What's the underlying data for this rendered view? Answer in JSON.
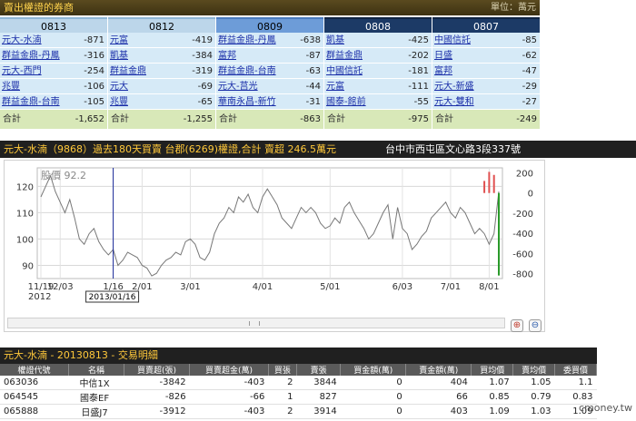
{
  "header": {
    "title": "賣出權證的券商",
    "unit": "單位：萬元"
  },
  "columns": [
    {
      "date": "0813",
      "rows": [
        {
          "name": "元大-水湳",
          "value": "-871"
        },
        {
          "name": "群益金鼎-丹鳳",
          "value": "-316"
        },
        {
          "name": "元大-西門",
          "value": "-254"
        },
        {
          "name": "兆豐",
          "value": "-106"
        },
        {
          "name": "群益金鼎-台南",
          "value": "-105"
        }
      ],
      "total_label": "合計",
      "total": "-1,652"
    },
    {
      "date": "0812",
      "rows": [
        {
          "name": "元富",
          "value": "-419"
        },
        {
          "name": "凱基",
          "value": "-384"
        },
        {
          "name": "群益金鼎",
          "value": "-319"
        },
        {
          "name": "元大",
          "value": "-69"
        },
        {
          "name": "兆豐",
          "value": "-65"
        }
      ],
      "total_label": "合計",
      "total": "-1,255"
    },
    {
      "date": "0809",
      "rows": [
        {
          "name": "群益金鼎-丹鳳",
          "value": "-638"
        },
        {
          "name": "富邦",
          "value": "-87"
        },
        {
          "name": "群益金鼎-台南",
          "value": "-63"
        },
        {
          "name": "元大-莒光",
          "value": "-44"
        },
        {
          "name": "華南永昌-新竹",
          "value": "-31"
        }
      ],
      "total_label": "合計",
      "total": "-863"
    },
    {
      "date": "0808",
      "rows": [
        {
          "name": "凱基",
          "value": "-425"
        },
        {
          "name": "群益金鼎",
          "value": "-202"
        },
        {
          "name": "中國信託",
          "value": "-181"
        },
        {
          "name": "元富",
          "value": "-111"
        },
        {
          "name": "國泰-館前",
          "value": "-55"
        }
      ],
      "total_label": "合計",
      "total": "-975"
    },
    {
      "date": "0807",
      "rows": [
        {
          "name": "中國信託",
          "value": "-85"
        },
        {
          "name": "日盛",
          "value": "-62"
        },
        {
          "name": "富邦",
          "value": "-47"
        },
        {
          "name": "元大-新盛",
          "value": "-29"
        },
        {
          "name": "元大-雙和",
          "value": "-27"
        }
      ],
      "total_label": "合計",
      "total": "-249"
    }
  ],
  "chart_title": "元大-水湳（9868）過去180天買賣 台郡(6269)權證,合計  賣超 246.5萬元",
  "chart_address": "台中市西屯區文心路3段337號",
  "chart_data": {
    "type": "line",
    "legend_label": "股價 92.2",
    "cursor_label": "2013/01/16",
    "x_ticks": [
      "11/19",
      "12/03",
      "1/16",
      "2/01",
      "3/01",
      "4/01",
      "5/01",
      "6/03",
      "7/01",
      "8/01"
    ],
    "year_labels": [
      "2012",
      "2013"
    ],
    "y_left_ticks": [
      90,
      100,
      110,
      120
    ],
    "y_right_ticks": [
      200,
      0,
      -200,
      -400,
      -600,
      -800
    ],
    "ylim_left": [
      85,
      127
    ],
    "ylim_right": [
      -850,
      250
    ],
    "price_series": [
      116,
      120,
      124,
      118,
      114,
      110,
      115,
      108,
      100,
      98,
      102,
      104,
      99,
      96,
      94,
      96,
      90,
      92,
      95,
      94,
      93,
      90,
      89,
      86,
      87,
      90,
      92,
      93,
      95,
      94,
      99,
      100,
      98,
      93,
      92,
      95,
      102,
      106,
      108,
      112,
      110,
      116,
      114,
      117,
      112,
      110,
      116,
      119,
      116,
      113,
      108,
      106,
      104,
      108,
      112,
      110,
      112,
      110,
      106,
      104,
      105,
      108,
      106,
      112,
      114,
      110,
      107,
      104,
      100,
      102,
      106,
      110,
      113,
      100,
      112,
      104,
      102,
      96,
      98,
      101,
      103,
      108,
      110,
      112,
      114,
      110,
      108,
      112,
      110,
      106,
      102,
      104,
      102,
      98,
      102,
      118
    ],
    "net_series": [
      0,
      0,
      0,
      0,
      0,
      0,
      0,
      0,
      0,
      0,
      0,
      0,
      0,
      0,
      0,
      0,
      0,
      0,
      0,
      0,
      0,
      0,
      0,
      0,
      0,
      0,
      0,
      0,
      0,
      0,
      0,
      0,
      0,
      0,
      0,
      0,
      0,
      0,
      0,
      0,
      0,
      0,
      0,
      0,
      0,
      0,
      0,
      0,
      0,
      0,
      0,
      0,
      0,
      0,
      0,
      0,
      0,
      0,
      0,
      0,
      0,
      0,
      0,
      0,
      0,
      0,
      0,
      0,
      0,
      0,
      0,
      0,
      0,
      0,
      0,
      0,
      0,
      0,
      0,
      0,
      0,
      0,
      0,
      0,
      0,
      0,
      0,
      0,
      0,
      0,
      0,
      0,
      120,
      210,
      180,
      -820
    ],
    "colors": {
      "price_line": "#777777",
      "buy": "#e05050",
      "sell": "#2a9a2a",
      "cursor": "#1a2a9a"
    }
  },
  "zoom": {
    "in_icon": "zoom-in-icon",
    "out_icon": "zoom-out-icon"
  },
  "detail_title": "元大-水湳 - 20130813 - 交易明細",
  "detail_headers": [
    "權證代號",
    "名稱",
    "買賣超(張)",
    "買賣超金(萬)",
    "買張",
    "賣張",
    "買金額(萬)",
    "賣金額(萬)",
    "買均價",
    "賣均價",
    "委買價"
  ],
  "detail_rows": [
    [
      "063036",
      "中信1X",
      "-3842",
      "-403",
      "2",
      "3844",
      "0",
      "404",
      "1.07",
      "1.05",
      "1.1"
    ],
    [
      "064545",
      "國泰EF",
      "-826",
      "-66",
      "1",
      "827",
      "0",
      "66",
      "0.85",
      "0.79",
      "0.83"
    ],
    [
      "065888",
      "日盛J7",
      "-3912",
      "-403",
      "2",
      "3914",
      "0",
      "403",
      "1.09",
      "1.03",
      "1.09"
    ]
  ],
  "watermark": "cmoney.tw"
}
